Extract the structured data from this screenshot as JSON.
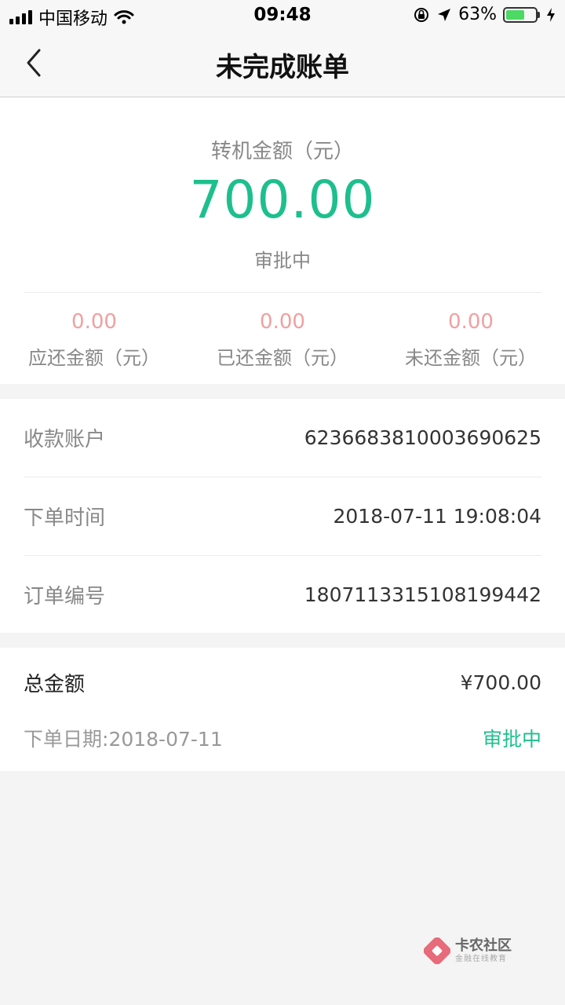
{
  "status_bar": {
    "carrier": "中国移动",
    "time": "09:48",
    "battery_percent": "63%",
    "battery_level": 0.63,
    "battery_color": "#4cd964"
  },
  "nav": {
    "back_icon": "chevron-left-icon",
    "title": "未完成账单"
  },
  "summary": {
    "label": "转机金额（元）",
    "amount": "700.00",
    "status": "审批中",
    "accent_color": "#1dbf8d",
    "stats": [
      {
        "value": "0.00",
        "label": "应还金额（元）"
      },
      {
        "value": "0.00",
        "label": "已还金额（元）"
      },
      {
        "value": "0.00",
        "label": "未还金额（元）"
      }
    ]
  },
  "details": [
    {
      "label": "收款账户",
      "value": "6236683810003690625"
    },
    {
      "label": "下单时间",
      "value": "2018-07-11 19:08:04"
    },
    {
      "label": "订单编号",
      "value": "1807113315108199442"
    }
  ],
  "total": {
    "label": "总金额",
    "amount": "¥700.00",
    "date_label": "下单日期:",
    "date_value": "2018-07-11",
    "status": "审批中"
  },
  "watermark": {
    "title": "卡农社区",
    "subtitle": "金融在线教育"
  }
}
